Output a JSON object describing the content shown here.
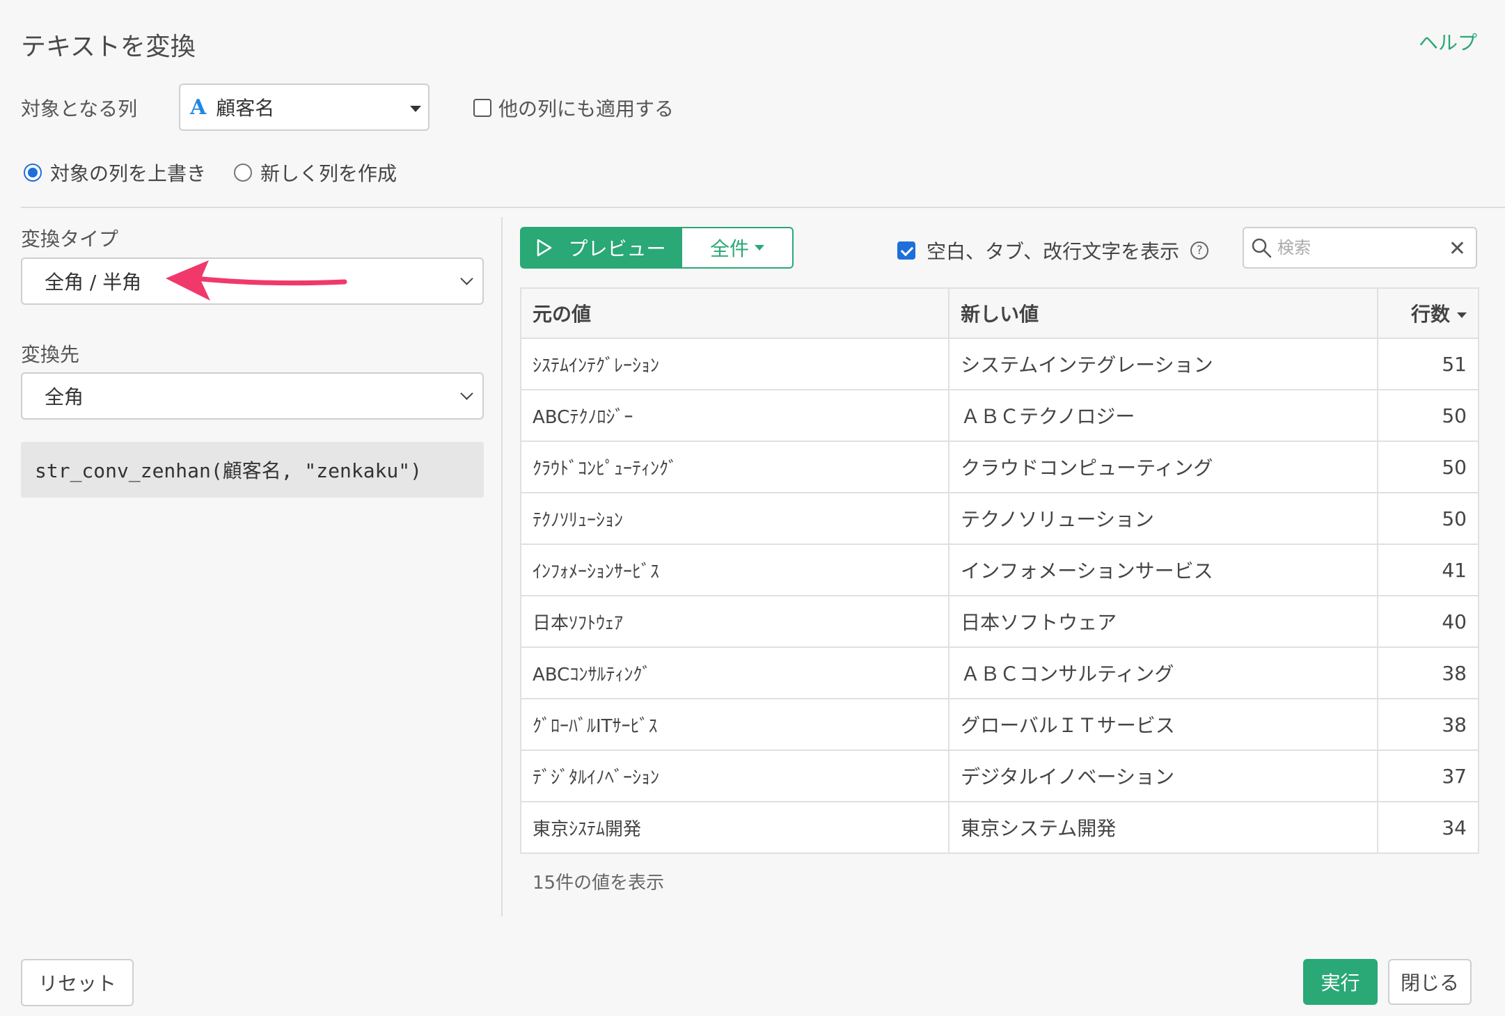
{
  "header": {
    "title": "テキストを変換",
    "help_label": "ヘルプ"
  },
  "target_column": {
    "label": "対象となる列",
    "type_icon": "A",
    "value": "顧客名",
    "apply_others_label": "他の列にも適用する",
    "apply_others_checked": false
  },
  "output_mode": {
    "overwrite_label": "対象の列を上書き",
    "new_column_label": "新しく列を作成",
    "selected": "overwrite"
  },
  "transform_type": {
    "label": "変換タイプ",
    "value": "全角 / 半角"
  },
  "destination": {
    "label": "変換先",
    "value": "全角"
  },
  "code": "str_conv_zenhan(顧客名, \"zenkaku\")",
  "toolbar": {
    "preview_label": "プレビュー",
    "all_label": "全件",
    "show_whitespace_label": "空白、タブ、改行文字を表示",
    "show_whitespace_checked": true,
    "search_placeholder": "検索"
  },
  "table": {
    "headers": {
      "original": "元の値",
      "new": "新しい値",
      "count": "行数"
    },
    "rows": [
      {
        "original": "ｼｽﾃﾑｲﾝﾃｸﾞﾚｰｼｮﾝ",
        "new": "システムインテグレーション",
        "count": "51"
      },
      {
        "original": "ABCﾃｸﾉﾛｼﾞｰ",
        "new": "ＡＢＣテクノロジー",
        "count": "50"
      },
      {
        "original": "ｸﾗｳﾄﾞｺﾝﾋﾟｭｰﾃｨﾝｸﾞ",
        "new": "クラウドコンピューティング",
        "count": "50"
      },
      {
        "original": "ﾃｸﾉｿﾘｭｰｼｮﾝ",
        "new": "テクノソリューション",
        "count": "50"
      },
      {
        "original": "ｲﾝﾌｫﾒｰｼｮﾝｻｰﾋﾞｽ",
        "new": "インフォメーションサービス",
        "count": "41"
      },
      {
        "original": "日本ｿﾌﾄｳｪｱ",
        "new": "日本ソフトウェア",
        "count": "40"
      },
      {
        "original": "ABCｺﾝｻﾙﾃｨﾝｸﾞ",
        "new": "ＡＢＣコンサルティング",
        "count": "38"
      },
      {
        "original": "ｸﾞﾛｰﾊﾞﾙITｻｰﾋﾞｽ",
        "new": "グローバルＩＴサービス",
        "count": "38"
      },
      {
        "original": "ﾃﾞｼﾞﾀﾙｲﾉﾍﾞｰｼｮﾝ",
        "new": "デジタルイノベーション",
        "count": "37"
      },
      {
        "original": "東京ｼｽﾃﾑ開発",
        "new": "東京システム開発",
        "count": "34"
      }
    ]
  },
  "footer_note": "15件の値を表示",
  "buttons": {
    "reset": "リセット",
    "run": "実行",
    "close": "閉じる"
  },
  "colors": {
    "accent_green": "#2aa876",
    "checkbox_blue": "#1e6fd9",
    "annotation_arrow": "#f0386b"
  }
}
